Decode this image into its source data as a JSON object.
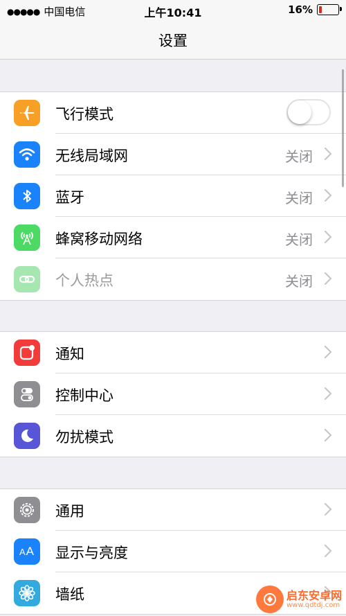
{
  "status_bar": {
    "carrier": "中国电信",
    "time": "上午10:41",
    "battery_text": "16%",
    "battery_level": 0.16,
    "low_battery_color": "#e0261f"
  },
  "nav": {
    "title": "设置"
  },
  "group1": [
    {
      "label": "飞行模式",
      "icon": "airplane-icon",
      "color": "#f7a025",
      "control": "toggle",
      "toggle_on": false
    },
    {
      "label": "无线局域网",
      "icon": "wifi-icon",
      "color": "#1a82fb",
      "value": "关闭"
    },
    {
      "label": "蓝牙",
      "icon": "bluetooth-icon",
      "color": "#1a82fb",
      "value": "关闭"
    },
    {
      "label": "蜂窝移动网络",
      "icon": "cellular-antenna-icon",
      "color": "#4cd964",
      "value": "关闭"
    },
    {
      "label": "个人热点",
      "icon": "hotspot-link-icon",
      "color": "#a6e6b0",
      "value": "关闭",
      "disabled": true
    }
  ],
  "group2": [
    {
      "label": "通知",
      "icon": "notifications-icon",
      "color": "#f23c3c"
    },
    {
      "label": "控制中心",
      "icon": "control-center-icon",
      "color": "#8e8e93"
    },
    {
      "label": "勿扰模式",
      "icon": "moon-icon",
      "color": "#5856d6"
    }
  ],
  "group3": [
    {
      "label": "通用",
      "icon": "gear-icon",
      "color": "#8e8e93"
    },
    {
      "label": "显示与亮度",
      "icon": "text-size-icon",
      "color": "#1a82fb",
      "icon_text": "AA"
    },
    {
      "label": "墙纸",
      "icon": "wallpaper-flower-icon",
      "color": "#33aadd"
    }
  ],
  "watermark": {
    "name": "启东安卓网",
    "url": "www.qdtdj.com"
  }
}
